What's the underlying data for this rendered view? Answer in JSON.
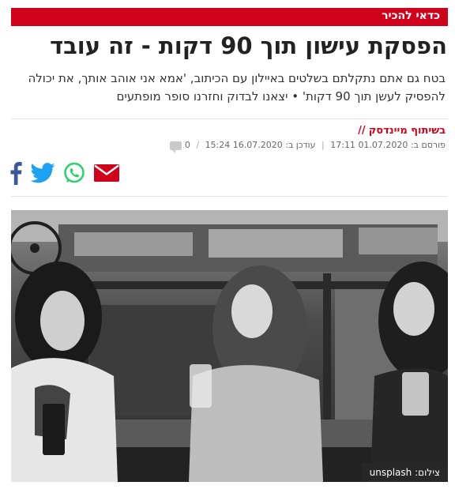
{
  "section_banner": "כדאי להכיר",
  "article": {
    "headline": "הפסקת עישון תוך 90 דקות - זה עובד",
    "subtitle": "בטח גם אתם נתקלתם בשלטים באיילון עם הכיתוב, 'אמא אני אוהב אותך, את יכולה להפסיק לעשן תוך 90 דקות' • יצאנו לבדוק וחזרנו סופר מופתעים",
    "byline_prefix": "בשיתוף מיינדסק",
    "byline_slashes": "//",
    "published_label": "פורסם ב:",
    "published": "01.07.2020 17:11",
    "updated_label": "עודכן ב:",
    "updated": "16.07.2020 15:24",
    "comments": "0"
  },
  "share": {
    "facebook": "facebook-icon",
    "twitter": "twitter-icon",
    "whatsapp": "whatsapp-icon",
    "email": "email-icon"
  },
  "photo": {
    "caption_label": "צילום:",
    "caption_credit": "unsplash"
  },
  "colors": {
    "brand_red": "#d0021b",
    "facebook_blue": "#3b5998",
    "twitter_blue": "#1da1f2",
    "whatsapp_green": "#25d366"
  }
}
